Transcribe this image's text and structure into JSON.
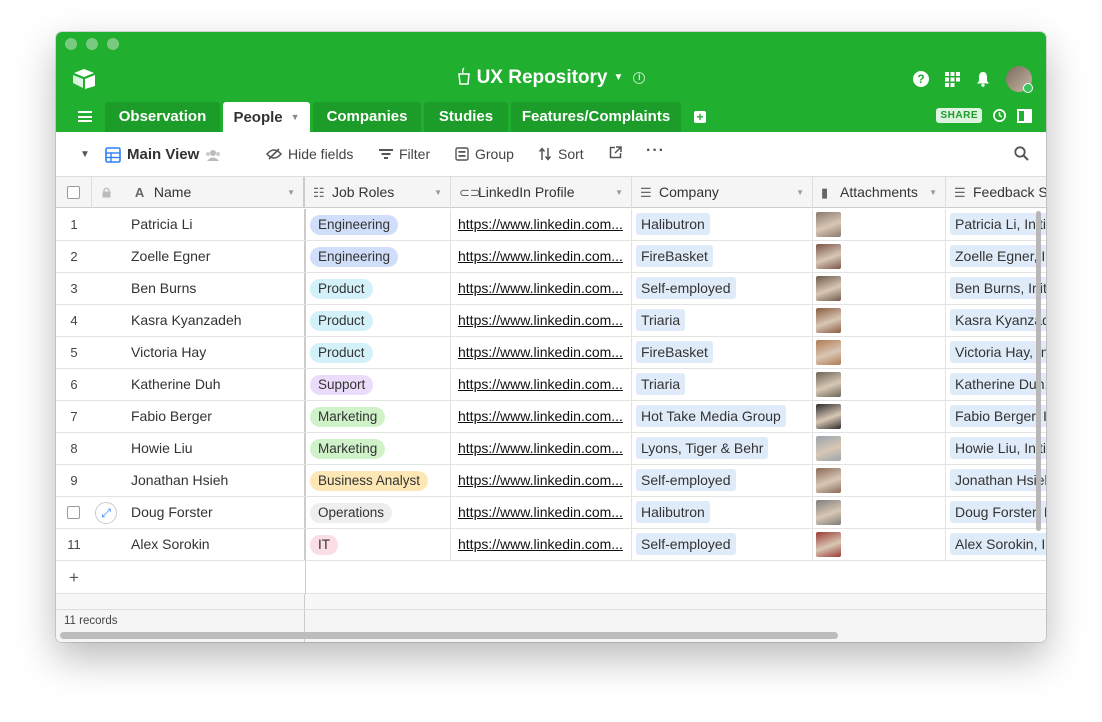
{
  "app": {
    "base_name": "UX Repository"
  },
  "tabs": [
    {
      "label": "Observation"
    },
    {
      "label": "People",
      "active": true
    },
    {
      "label": "Companies"
    },
    {
      "label": "Studies"
    },
    {
      "label": "Features/Complaints"
    }
  ],
  "header_actions": {
    "share_label": "SHARE"
  },
  "toolbar": {
    "view_name": "Main View",
    "hide_fields": "Hide fields",
    "filter": "Filter",
    "group": "Group",
    "sort": "Sort"
  },
  "columns": {
    "name": "Name",
    "job_roles": "Job Roles",
    "linkedin": "LinkedIn Profile",
    "company": "Company",
    "attachments": "Attachments",
    "feedback": "Feedback Se"
  },
  "rows": [
    {
      "num": "1",
      "name": "Patricia Li",
      "role": "Engineering",
      "role_color": "#d0defa",
      "linkedin": "https://www.linkedin.com...",
      "company": "Halibutron",
      "feedback": "Patricia Li, Initia"
    },
    {
      "num": "2",
      "name": "Zoelle Egner",
      "role": "Engineering",
      "role_color": "#d0defa",
      "linkedin": "https://www.linkedin.com...",
      "company": "FireBasket",
      "feedback": "Zoelle Egner, In"
    },
    {
      "num": "3",
      "name": "Ben Burns",
      "role": "Product",
      "role_color": "#d2f1f9",
      "linkedin": "https://www.linkedin.com...",
      "company": "Self-employed",
      "feedback": "Ben Burns, Initia"
    },
    {
      "num": "4",
      "name": "Kasra Kyanzadeh",
      "role": "Product",
      "role_color": "#d2f1f9",
      "linkedin": "https://www.linkedin.com...",
      "company": "Triaria",
      "feedback": "Kasra Kyanzade"
    },
    {
      "num": "5",
      "name": "Victoria Hay",
      "role": "Product",
      "role_color": "#d2f1f9",
      "linkedin": "https://www.linkedin.com...",
      "company": "FireBasket",
      "feedback": "Victoria Hay, In"
    },
    {
      "num": "6",
      "name": "Katherine Duh",
      "role": "Support",
      "role_color": "#ecdcfb",
      "linkedin": "https://www.linkedin.com...",
      "company": "Triaria",
      "feedback": "Katherine Duh, I"
    },
    {
      "num": "7",
      "name": "Fabio Berger",
      "role": "Marketing",
      "role_color": "#cff2c9",
      "linkedin": "https://www.linkedin.com...",
      "company": "Hot Take Media Group",
      "feedback": "Fabio Berger, In"
    },
    {
      "num": "8",
      "name": "Howie Liu",
      "role": "Marketing",
      "role_color": "#cff2c9",
      "linkedin": "https://www.linkedin.com...",
      "company": "Lyons, Tiger & Behr",
      "feedback": "Howie Liu, Initia"
    },
    {
      "num": "9",
      "name": "Jonathan Hsieh",
      "role": "Business Analyst",
      "role_color": "#fde8b5",
      "linkedin": "https://www.linkedin.com...",
      "company": "Self-employed",
      "feedback": "Jonathan Hsieh"
    },
    {
      "num": "",
      "name": "Doug Forster",
      "role": "Operations",
      "role_color": "#eeeeee",
      "linkedin": "https://www.linkedin.com...",
      "company": "Halibutron",
      "feedback": "Doug Forster, In"
    },
    {
      "num": "11",
      "name": "Alex Sorokin",
      "role": "IT",
      "role_color": "#fbdde6",
      "linkedin": "https://www.linkedin.com...",
      "company": "Self-employed",
      "feedback": "Alex Sorokin, In"
    }
  ],
  "footer": {
    "record_count": "11 records"
  }
}
